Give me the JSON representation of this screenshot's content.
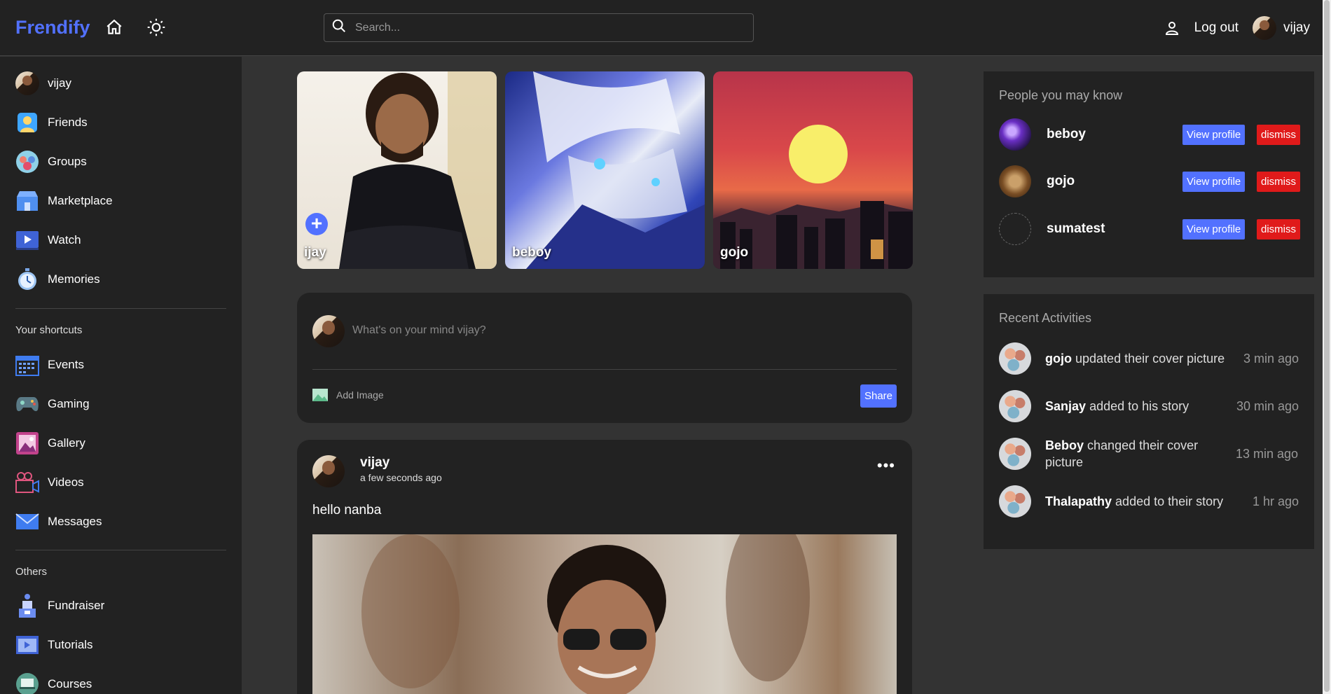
{
  "app": {
    "logo": "Frendify"
  },
  "header": {
    "search_placeholder": "Search...",
    "logout_label": "Log out",
    "username": "vijay"
  },
  "sidebar": {
    "user": "vijay",
    "items": [
      {
        "label": "Friends",
        "icon": "friends-icon"
      },
      {
        "label": "Groups",
        "icon": "groups-icon"
      },
      {
        "label": "Marketplace",
        "icon": "marketplace-icon"
      },
      {
        "label": "Watch",
        "icon": "watch-icon"
      },
      {
        "label": "Memories",
        "icon": "memories-icon"
      }
    ],
    "shortcuts_heading": "Your shortcuts",
    "shortcuts": [
      {
        "label": "Events",
        "icon": "calendar-icon"
      },
      {
        "label": "Gaming",
        "icon": "gamepad-icon"
      },
      {
        "label": "Gallery",
        "icon": "gallery-icon"
      },
      {
        "label": "Videos",
        "icon": "video-camera-icon"
      },
      {
        "label": "Messages",
        "icon": "envelope-icon"
      }
    ],
    "others_heading": "Others",
    "others": [
      {
        "label": "Fundraiser",
        "icon": "fundraiser-icon"
      },
      {
        "label": "Tutorials",
        "icon": "tutorials-icon"
      },
      {
        "label": "Courses",
        "icon": "courses-icon"
      }
    ]
  },
  "stories": [
    {
      "name": "ijay"
    },
    {
      "name": "beboy"
    },
    {
      "name": "gojo"
    }
  ],
  "composer": {
    "placeholder": "What's on your mind vijay?",
    "add_image_label": "Add Image",
    "share_label": "Share"
  },
  "post": {
    "author": "vijay",
    "time": "a few seconds ago",
    "text": "hello nanba"
  },
  "suggestions": {
    "title": "People you may know",
    "view_label": "View profile",
    "dismiss_label": "dismiss",
    "people": [
      {
        "name": "beboy"
      },
      {
        "name": "gojo"
      },
      {
        "name": "sumatest"
      }
    ]
  },
  "activities": {
    "title": "Recent Activities",
    "items": [
      {
        "user": "gojo",
        "action": "updated their cover picture",
        "time": "3 min ago"
      },
      {
        "user": "Sanjay",
        "action": "added to his story",
        "time": "30 min ago"
      },
      {
        "user": "Beboy",
        "action": "changed their cover picture",
        "time": "13 min ago"
      },
      {
        "user": "Thalapathy",
        "action": "added to their story",
        "time": "1 hr ago"
      }
    ]
  },
  "colors": {
    "accent": "#5271ff",
    "danger": "#e01a1a",
    "background": "#333333",
    "panel": "#222222"
  }
}
